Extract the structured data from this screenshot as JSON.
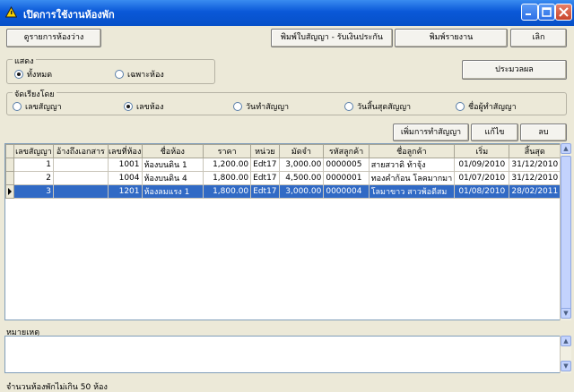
{
  "window": {
    "title": "เปิดการใช้งานห้องพัก"
  },
  "toolbar": {
    "vacant_rooms": "ดูรายการห้องว่าง",
    "print_contract": "พิมพ์ใบสัญญา - รับเงินประกัน",
    "print_report": "พิมพ์รายงาน",
    "exit": "เลิก",
    "process": "ประมวลผล"
  },
  "display_group": {
    "label": "แสดง",
    "options": [
      {
        "label": "ทั้งหมด",
        "selected": true
      },
      {
        "label": "เฉพาะห้อง",
        "selected": false
      }
    ]
  },
  "sort_group": {
    "label": "จัดเรียงโดย",
    "options": [
      {
        "label": "เลขสัญญา",
        "selected": false
      },
      {
        "label": "เลขห้อง",
        "selected": true
      },
      {
        "label": "วันทำสัญญา",
        "selected": false
      },
      {
        "label": "วันสิ้นสุดสัญญา",
        "selected": false
      },
      {
        "label": "ชื่อผู้ทำสัญญา",
        "selected": false
      }
    ]
  },
  "actions": {
    "add": "เพิ่มการทำสัญญา",
    "edit": "แก้ไข",
    "delete": "ลบ"
  },
  "table": {
    "columns": [
      "เลขสัญญา",
      "อ้างถึงเอกสาร",
      "เลขที่ห้อง",
      "ชื่อห้อง",
      "ราคา",
      "หน่วย",
      "มัดจำ",
      "รหัสลูกค้า",
      "ชื่อลูกค้า",
      "เริ่ม",
      "สิ้นสุด",
      "#"
    ],
    "rows": [
      {
        "contract": "1",
        "doc_ref": "",
        "room_no": "1001",
        "room_name": "ห้องบนดิน 1",
        "price": "1,200.00",
        "unit": "Edt17",
        "deposit": "3,000.00",
        "cust_id": "0000005",
        "cust_name": "สายสวาดิ ท้าจุ้ง",
        "start": "01/09/2010",
        "end": "31/12/2010",
        "flag": "1",
        "selected": false
      },
      {
        "contract": "2",
        "doc_ref": "",
        "room_no": "1004",
        "room_name": "ห้องบนดิน 4",
        "price": "1,800.00",
        "unit": "Edt17",
        "deposit": "4,500.00",
        "cust_id": "0000001",
        "cust_name": "ทองคำก้อน โลคมากมา",
        "start": "01/07/2010",
        "end": "31/12/2010",
        "flag": "1",
        "selected": false
      },
      {
        "contract": "3",
        "doc_ref": "",
        "room_no": "1201",
        "room_name": "ห้องลมแรง 1",
        "price": "1,800.00",
        "unit": "Edt17",
        "deposit": "3,000.00",
        "cust_id": "0000004",
        "cust_name": "โลมาขาว สาวพ้อดีสม",
        "start": "01/08/2010",
        "end": "28/02/2011",
        "flag": "1",
        "selected": true
      }
    ]
  },
  "notes": {
    "label": "หมายเหตุ",
    "value": ""
  },
  "status": {
    "text": "จำนวนห้องพักไม่เกิน 50 ห้อง"
  },
  "colors": {
    "titlebar": "#0a58d8",
    "selection": "#316ac5",
    "background": "#ece9d8"
  }
}
